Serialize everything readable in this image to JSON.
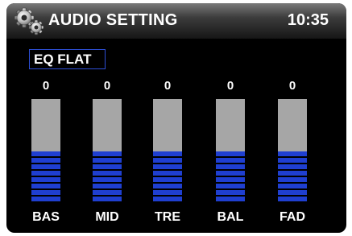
{
  "header": {
    "title": "AUDIO SETTING",
    "time": "10:35",
    "icon": "gears-icon"
  },
  "eq": {
    "preset": "EQ FLAT"
  },
  "channels": [
    {
      "label": "BAS",
      "value": "0",
      "level": 0.5
    },
    {
      "label": "MID",
      "value": "0",
      "level": 0.5
    },
    {
      "label": "TRE",
      "value": "0",
      "level": 0.5
    },
    {
      "label": "BAL",
      "value": "0",
      "level": 0.5
    },
    {
      "label": "FAD",
      "value": "0",
      "level": 0.5
    }
  ],
  "colors": {
    "background": "#000000",
    "bar_track": "#a6a6a6",
    "bar_fill": "#1f3fd0",
    "accent_border": "#2d4fd6",
    "text": "#ffffff"
  }
}
